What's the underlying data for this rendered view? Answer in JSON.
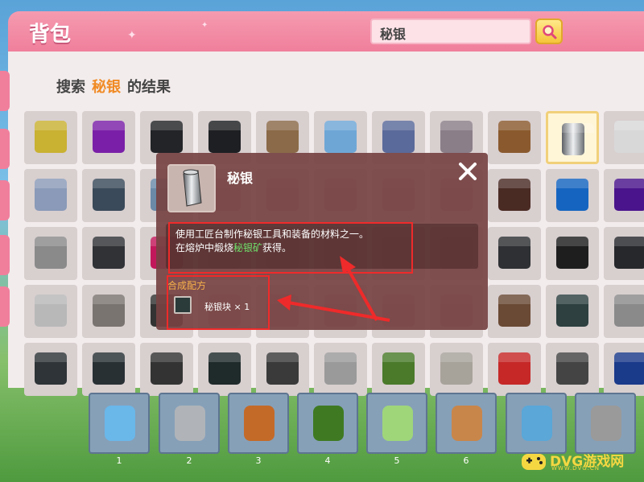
{
  "header": {
    "title": "背包",
    "search_value": "秘银"
  },
  "result": {
    "prefix": "搜索",
    "keyword": "秘银",
    "suffix": "的结果"
  },
  "grid_items": [
    {
      "icon": "yellow-cube",
      "color": "#c9b132"
    },
    {
      "icon": "purple-cube",
      "color": "#7a20a8"
    },
    {
      "icon": "black-cube",
      "color": "#222427"
    },
    {
      "icon": "black-cube",
      "color": "#1d1f22"
    },
    {
      "icon": "belt-icon",
      "color": "#8a6a48"
    },
    {
      "icon": "blue-cube",
      "color": "#6ea7d6"
    },
    {
      "icon": "pitchfork-icon",
      "color": "#5a6a9a"
    },
    {
      "icon": "bow-icon",
      "color": "#8a7e88"
    },
    {
      "icon": "axe-icon",
      "color": "#8a5a2e"
    },
    {
      "icon": "mithril-ingot-icon",
      "color": "#9aa2a8"
    },
    {
      "icon": "cloth-icon",
      "color": "#d8d8d8"
    },
    {
      "icon": "scissors-icon",
      "color": "#8a9ab8"
    },
    {
      "icon": "hammer-icon",
      "color": "#3a4a5a"
    },
    {
      "icon": "helmet-icon",
      "color": "#6a8aa8"
    },
    {
      "icon": "cube",
      "color": "#b9a59f"
    },
    {
      "icon": "cube",
      "color": "#b9a59f"
    },
    {
      "icon": "cube",
      "color": "#b9a59f"
    },
    {
      "icon": "cube",
      "color": "#b9a59f"
    },
    {
      "icon": "cube",
      "color": "#b9a59f"
    },
    {
      "icon": "brown-cube",
      "color": "#4a2b24"
    },
    {
      "icon": "blue-cube",
      "color": "#1565c0"
    },
    {
      "icon": "purple-cube",
      "color": "#4a148c"
    },
    {
      "icon": "gray-cube",
      "color": "#8a8a8a"
    },
    {
      "icon": "dark-cube",
      "color": "#303236"
    },
    {
      "icon": "pink-cube",
      "color": "#c2185b"
    },
    {
      "icon": "cube",
      "color": "#b9a59f"
    },
    {
      "icon": "cube",
      "color": "#b9a59f"
    },
    {
      "icon": "cube",
      "color": "#b9a59f"
    },
    {
      "icon": "cube",
      "color": "#b9a59f"
    },
    {
      "icon": "cube",
      "color": "#b9a59f"
    },
    {
      "icon": "dark-cube",
      "color": "#2e3033"
    },
    {
      "icon": "grate-cube",
      "color": "#1e1e1e"
    },
    {
      "icon": "dark-cube",
      "color": "#26282c"
    },
    {
      "icon": "gray-cube",
      "color": "#b8b8b8"
    },
    {
      "icon": "mesh-cube",
      "color": "#7a7470"
    },
    {
      "icon": "dark-cube",
      "color": "#333"
    },
    {
      "icon": "cube",
      "color": "#b9a59f"
    },
    {
      "icon": "cube",
      "color": "#b9a59f"
    },
    {
      "icon": "cube",
      "color": "#b9a59f"
    },
    {
      "icon": "cube",
      "color": "#b9a59f"
    },
    {
      "icon": "cube",
      "color": "#b9a59f"
    },
    {
      "icon": "spool-icon",
      "color": "#6a4a34"
    },
    {
      "icon": "door-icon",
      "color": "#2e4040"
    },
    {
      "icon": "furnace-cart-icon",
      "color": "#8a8a8a"
    },
    {
      "icon": "stairs-cube",
      "color": "#2e3438"
    },
    {
      "icon": "slab-cube",
      "color": "#283034"
    },
    {
      "icon": "fence-icon",
      "color": "#333"
    },
    {
      "icon": "dark-cube",
      "color": "#1f2a2a"
    },
    {
      "icon": "ore-cube",
      "color": "#3a3a3a"
    },
    {
      "icon": "stone-cube",
      "color": "#9a9a9a"
    },
    {
      "icon": "mossy-cube",
      "color": "#4a7a2a"
    },
    {
      "icon": "stone-cube",
      "color": "#a7a29a"
    },
    {
      "icon": "lava-cube",
      "color": "#c62828"
    },
    {
      "icon": "ore-cube",
      "color": "#444"
    },
    {
      "icon": "blue-ore-cube",
      "color": "#1a3a8a"
    }
  ],
  "detail": {
    "title": "秘银",
    "desc_line1": "使用工匠台制作秘银工具和装备的材料之一。",
    "desc_line2_pre": "在熔炉中煅烧",
    "desc_line2_highlight": "秘银矿",
    "desc_line2_post": "获得。",
    "recipe_label": "合成配方",
    "recipe_item": "秘银块 × 1"
  },
  "hotbar": [
    {
      "num": "1",
      "icon": "bottle-icon"
    },
    {
      "num": "2",
      "icon": "bucket-icon"
    },
    {
      "num": "3",
      "icon": "torch-icon"
    },
    {
      "num": "4",
      "icon": "grass-block-icon"
    },
    {
      "num": "5",
      "icon": "seeds-icon"
    },
    {
      "num": "6",
      "icon": "rake-icon"
    },
    {
      "num": "",
      "icon": "blue-egg-icon"
    },
    {
      "num": "",
      "icon": "kiln-icon"
    }
  ],
  "watermark": {
    "main": "DVG游戏网",
    "sub": "WWW.DVG.CN"
  },
  "colors": {
    "header_pink": "#f07f9c",
    "highlight_orange": "#f08a24",
    "annotation_red": "#ef2a2a",
    "highlight_green": "#6fe36b"
  }
}
